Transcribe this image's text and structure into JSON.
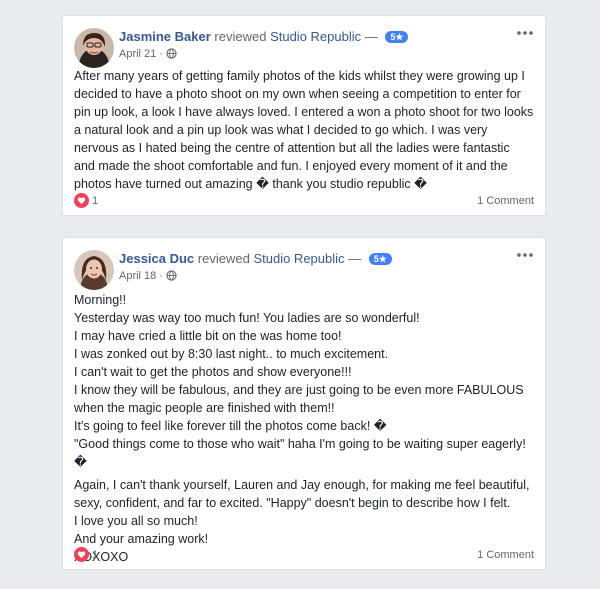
{
  "reviews": [
    {
      "author": "Jasmine Baker",
      "verb": "reviewed",
      "page": "Studio Republic",
      "dash": "—",
      "rating": "5★",
      "date": "April 21",
      "paragraphs": [
        "After many years of getting family photos of the kids whilst they were growing up I decided to have a photo shoot on my own when seeing a competition to enter for pin up look, a look I have always loved. I entered a won a photo shoot for two looks a natural look and a pin up look was what I decided to go which. I was very nervous as I hated being the centre of attention but all the ladies were fantastic and made the shoot comfortable and fun. I enjoyed every moment of it and the photos have turned out amazing � thank you studio republic �"
      ],
      "likes": "1",
      "comments": "1 Comment"
    },
    {
      "author": "Jessica Duc",
      "verb": "reviewed",
      "page": "Studio Republic",
      "dash": "—",
      "rating": "5★",
      "date": "April 18",
      "paragraphs": [
        "Morning!!\nYesterday was way too much fun! You ladies are so wonderful!\nI may have cried a little bit on the was home too!\nI was zonked out by 8:30 last night.. to much excitement.\nI can't wait to get the photos and show everyone!!!\nI know they will be fabulous, and they are just going to be even more FABULOUS when the magic people are finished with them!!\nIt's going to feel like forever till the photos come back! �\n\"Good things come to those who wait\" haha I'm going to be waiting super eagerly! �",
        "Again, I can't thank yourself, Lauren and Jay enough, for making me feel beautiful, sexy, confident, and far to excited. \"Happy\" doesn't begin to describe how I felt.\nI love you all so much!\nAnd your amazing work!\nXOXOXO"
      ],
      "likes": "1",
      "comments": "1 Comment"
    }
  ],
  "colors": {
    "background": "#e9ebee",
    "link": "#365899",
    "badge": "#4080ff",
    "heart": "#f33e58",
    "meta": "#616770"
  },
  "icons": [
    "avatar",
    "globe-icon",
    "more-icon",
    "heart-icon"
  ]
}
